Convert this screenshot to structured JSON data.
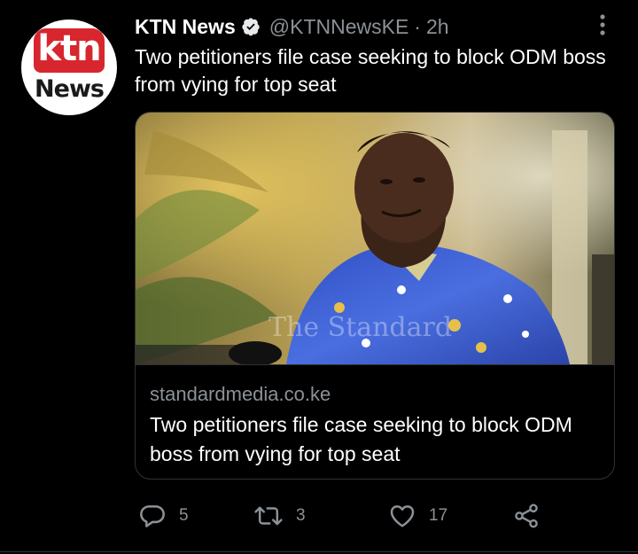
{
  "tweet": {
    "avatar": {
      "logo_top": "ktn",
      "logo_bottom": "News"
    },
    "display_name": "KTN News",
    "handle": "@KTNNewsKE",
    "separator": "·",
    "time": "2h",
    "text": "Two petitioners file case seeking to block ODM boss from vying for top seat",
    "card": {
      "domain": "standardmedia.co.ke",
      "title": "Two petitioners file case seeking to block ODM boss from vying for top seat",
      "watermark": "The Standard"
    },
    "actions": {
      "replies": "5",
      "retweets": "3",
      "likes": "17"
    }
  },
  "colors": {
    "background": "#000000",
    "text_primary": "#ffffff",
    "text_secondary": "#8b9196",
    "border": "#2f3336",
    "ktn_red": "#d7262d",
    "verified_badge": "#e7e9ea"
  },
  "icons": {
    "verified": "verified-badge-icon",
    "more": "more-vertical-icon",
    "reply": "reply-icon",
    "retweet": "retweet-icon",
    "like": "heart-icon",
    "share": "share-icon"
  }
}
